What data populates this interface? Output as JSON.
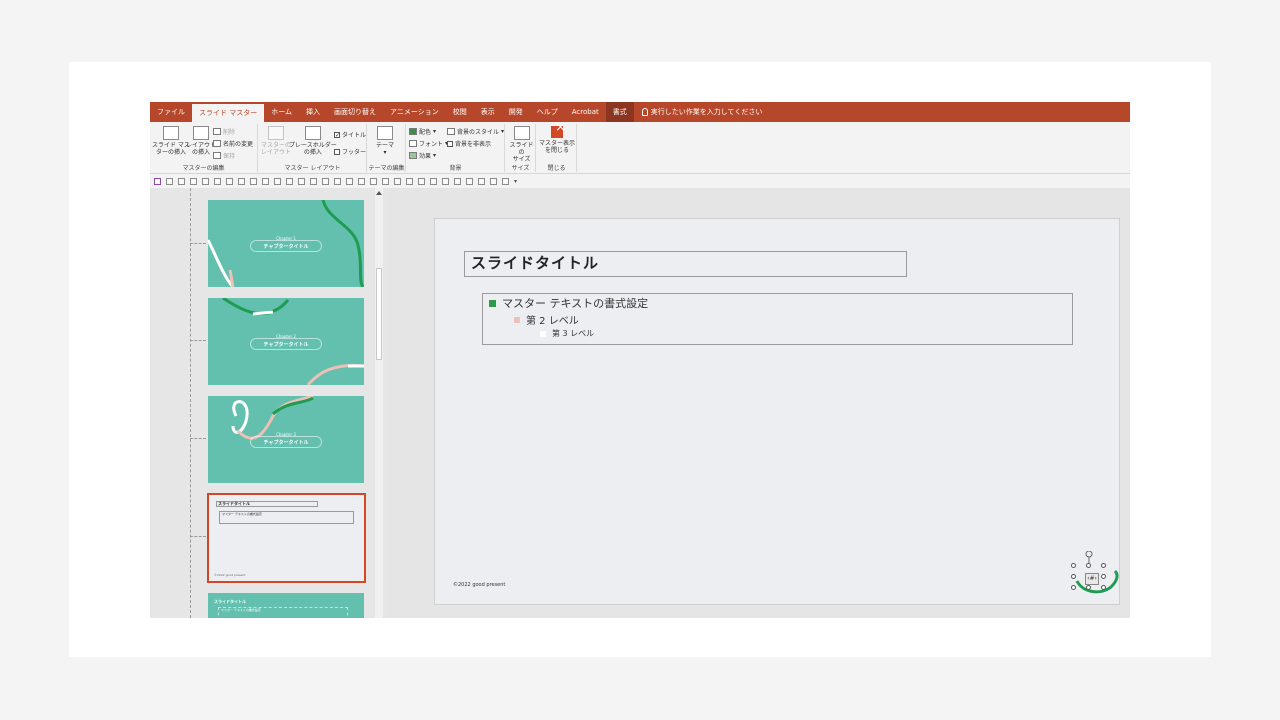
{
  "tabs": [
    {
      "label": "ファイル",
      "state": "normal"
    },
    {
      "label": "スライド マスター",
      "state": "active"
    },
    {
      "label": "ホーム",
      "state": "normal"
    },
    {
      "label": "挿入",
      "state": "normal"
    },
    {
      "label": "画面切り替え",
      "state": "normal"
    },
    {
      "label": "アニメーション",
      "state": "normal"
    },
    {
      "label": "校閲",
      "state": "normal"
    },
    {
      "label": "表示",
      "state": "normal"
    },
    {
      "label": "開発",
      "state": "normal"
    },
    {
      "label": "ヘルプ",
      "state": "normal"
    },
    {
      "label": "Acrobat",
      "state": "normal"
    },
    {
      "label": "書式",
      "state": "context"
    }
  ],
  "tell_me": "実行したい作業を入力してください",
  "ribbon": {
    "edit_master": {
      "insert_master_l1": "スライド マス",
      "insert_master_l2": "ターの挿入",
      "insert_layout_l1": "レイアウト",
      "insert_layout_l2": "の挿入",
      "delete": "削除",
      "rename": "名前の変更",
      "preserve": "保持",
      "label": "マスターの編集"
    },
    "master_layout": {
      "master_layout_l1": "マスターの",
      "master_layout_l2": "レイアウト",
      "insert_placeholder_l1": "プレースホルダー",
      "insert_placeholder_l2": "の挿入",
      "title_checkbox": "タイトル",
      "title_checked": true,
      "footer_checkbox": "フッター",
      "footer_checked": false,
      "label": "マスター レイアウト"
    },
    "edit_theme": {
      "themes": "テーマ",
      "label": "テーマの編集"
    },
    "background": {
      "colors": "配色",
      "fonts": "フォント",
      "effects": "効果",
      "background_styles": "背景のスタイル",
      "hide_background": "背景を非表示",
      "hide_background_checked": false,
      "label": "背景"
    },
    "size": {
      "slide_size_l1": "スライドの",
      "slide_size_l2": "サイズ",
      "label": "サイズ"
    },
    "close": {
      "close_master_l1": "マスター表示",
      "close_master_l2": "を閉じる",
      "label": "閉じる"
    }
  },
  "thumbnails": [
    {
      "chapter": "Chapter 1",
      "title": "チャプタータイトル"
    },
    {
      "chapter": "Chapter 2",
      "title": "チャプタータイトル"
    },
    {
      "chapter": "Chapter 3",
      "title": "チャプタータイトル"
    },
    {
      "title": "スライドタイトル",
      "body": "マスター テキストの書式設定",
      "selected": true
    },
    {
      "title": "スライドタイトル",
      "body": "マスター テキストの書式設定"
    }
  ],
  "slide": {
    "title": "スライドタイトル",
    "level1": "マスター テキストの書式設定",
    "level2": "第 2 レベル",
    "level3": "第 3 レベル",
    "footer": "©2022 good present",
    "page_number": "‹#›"
  },
  "colors": {
    "accent": "#b7472a",
    "teal": "#63bfae",
    "green_bullet": "#2e9a4a",
    "pink_bullet": "#efc0b6",
    "selection": "#d24726"
  }
}
